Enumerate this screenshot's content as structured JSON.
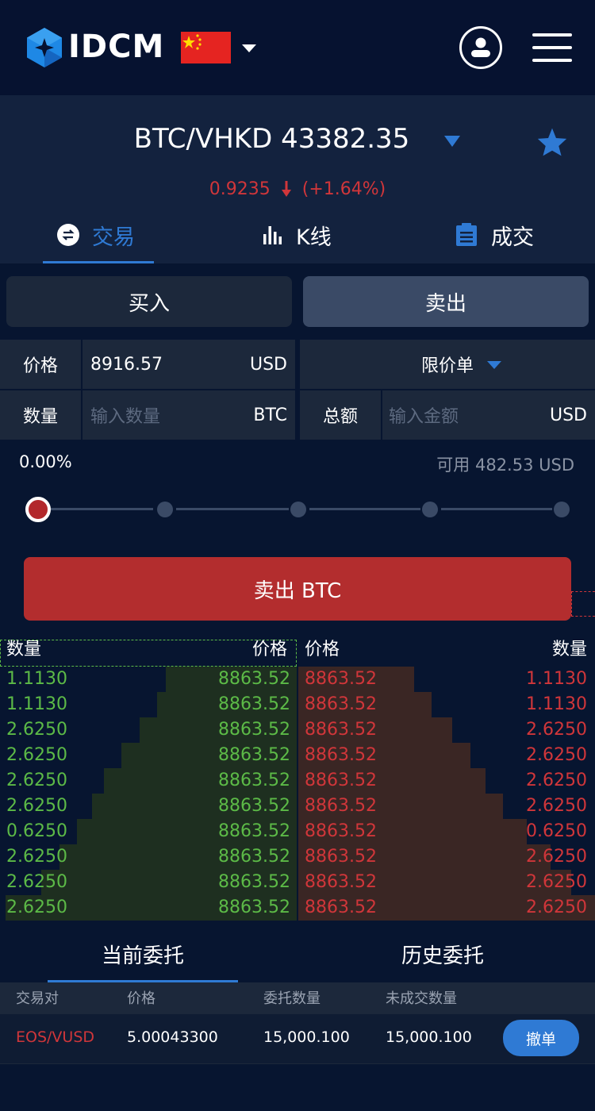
{
  "header": {
    "logo_text": "IDCM",
    "colors": {
      "brand": "#2f7ad4",
      "flag": "#e52421"
    }
  },
  "ticker": {
    "pair": "BTC/VHKD 43382.35",
    "change_value": "0.9235",
    "change_percent": "(+1.64%)",
    "colors": {
      "down": "#d0363a",
      "star": "#2f7ad4"
    }
  },
  "tabs": [
    {
      "label": "交易",
      "icon": "exchange-icon",
      "active": true
    },
    {
      "label": "K线",
      "icon": "bar-chart-icon",
      "active": false
    },
    {
      "label": "成交",
      "icon": "clipboard-icon",
      "active": false
    }
  ],
  "trade": {
    "buy_label": "买入",
    "sell_label": "卖出",
    "price_label": "价格",
    "price_value": "8916.57",
    "price_unit": "USD",
    "order_type": "限价单",
    "qty_label": "数量",
    "qty_placeholder": "输入数量",
    "qty_unit": "BTC",
    "total_label": "总额",
    "total_placeholder": "输入金额",
    "total_unit": "USD",
    "percent": "0.00%",
    "available": "可用 482.53 USD",
    "slider_level": 0,
    "cta": "卖出 BTC"
  },
  "orderbook": {
    "bid_qty_header": "数量",
    "bid_price_header": "价格",
    "ask_price_header": "价格",
    "ask_qty_header": "数量",
    "bids": [
      {
        "qty": "1.1130",
        "price": "8863.52",
        "depth": 0.44
      },
      {
        "qty": "1.1130",
        "price": "8863.52",
        "depth": 0.47
      },
      {
        "qty": "2.6250",
        "price": "8863.52",
        "depth": 0.53
      },
      {
        "qty": "2.6250",
        "price": "8863.52",
        "depth": 0.59
      },
      {
        "qty": "2.6250",
        "price": "8863.52",
        "depth": 0.65
      },
      {
        "qty": "2.6250",
        "price": "8863.52",
        "depth": 0.69
      },
      {
        "qty": "0.6250",
        "price": "8863.52",
        "depth": 0.74
      },
      {
        "qty": "2.6250",
        "price": "8863.52",
        "depth": 0.8
      },
      {
        "qty": "2.6250",
        "price": "8863.52",
        "depth": 0.86
      },
      {
        "qty": "2.6250",
        "price": "8863.52",
        "depth": 0.98
      }
    ],
    "asks": [
      {
        "price": "8863.52",
        "qty": "1.1130",
        "depth": 0.39
      },
      {
        "price": "8863.52",
        "qty": "1.1130",
        "depth": 0.45
      },
      {
        "price": "8863.52",
        "qty": "2.6250",
        "depth": 0.52
      },
      {
        "price": "8863.52",
        "qty": "2.6250",
        "depth": 0.58
      },
      {
        "price": "8863.52",
        "qty": "2.6250",
        "depth": 0.63
      },
      {
        "price": "8863.52",
        "qty": "2.6250",
        "depth": 0.69
      },
      {
        "price": "8863.52",
        "qty": "0.6250",
        "depth": 0.77
      },
      {
        "price": "8863.52",
        "qty": "2.6250",
        "depth": 0.85
      },
      {
        "price": "8863.52",
        "qty": "2.6250",
        "depth": 0.92
      },
      {
        "price": "8863.52",
        "qty": "2.6250",
        "depth": 1.0
      }
    ],
    "colors": {
      "bid": "#5cba47",
      "ask": "#d0363a"
    }
  },
  "orders": {
    "tab_current": "当前委托",
    "tab_history": "历史委托",
    "columns": [
      "交易对",
      "价格",
      "委托数量",
      "未成交数量"
    ],
    "rows": [
      {
        "pair": "EOS/VUSD",
        "price": "5.00043300",
        "amount": "15,000.100",
        "unfilled": "15,000.100",
        "action": "撤单"
      }
    ]
  }
}
